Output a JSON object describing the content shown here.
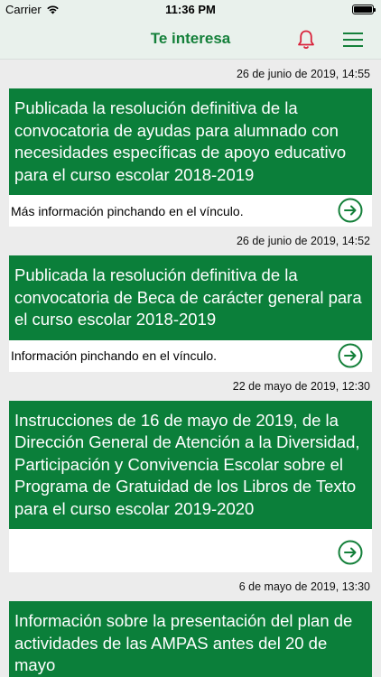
{
  "status_bar": {
    "carrier": "Carrier",
    "time": "11:36 PM"
  },
  "nav": {
    "title": "Te interesa",
    "icons": [
      "bell-icon",
      "menu-icon"
    ],
    "accent_color": "#14803a",
    "bell_color": "#d9233b"
  },
  "news": [
    {
      "date": "26 de junio de 2019, 14:55",
      "title": "Publicada la resolución definitiva de la convocatoria de ayudas para alumnado con necesidades específicas de apoyo educativo para el curso escolar 2018-2019",
      "description": "Más información pinchando en el vínculo."
    },
    {
      "date": "26 de junio de 2019, 14:52",
      "title": "Publicada la resolución definitiva de la convocatoria de Beca de carácter general para el curso escolar 2018-2019",
      "description": "Información pinchando en el vínculo."
    },
    {
      "date": "22 de mayo de 2019, 12:30",
      "title": "Instrucciones de 16 de mayo de 2019, de la Dirección General de Atención a la Diversidad, Participación y Convivencia Escolar sobre el Programa de Gratuidad de los Libros de Texto para el curso escolar 2019-2020",
      "description": ""
    },
    {
      "date": "6 de mayo de 2019, 13:30",
      "title": "Información sobre la presentación del plan de actividades de las AMPAS antes del 20 de mayo",
      "description": ""
    }
  ],
  "colors": {
    "card_green": "#0b7f3a",
    "arrow_green": "#14803a"
  }
}
